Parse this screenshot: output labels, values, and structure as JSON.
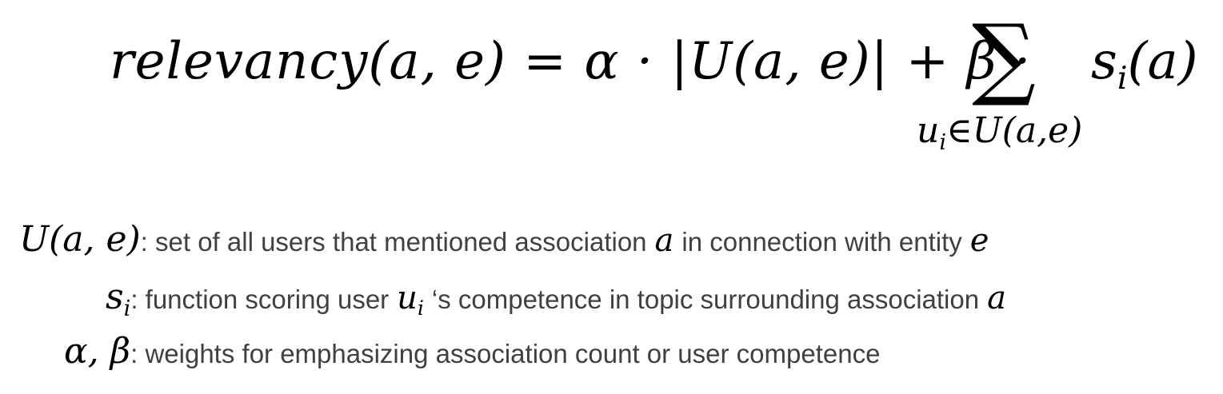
{
  "formula": {
    "lhs": "relevancy(a, e)",
    "equals": "=",
    "alpha_term": "α · |U(a, e)| + β ·",
    "sum_symbol": "∑",
    "sum_subscript_var": "u",
    "sum_subscript_index": "i",
    "sum_subscript_rest": "∈U(a,e)",
    "summand_var": "s",
    "summand_index": "i",
    "summand_arg": "(a)"
  },
  "definitions": [
    {
      "symbol": "U(a, e)",
      "text_before": ": set of all users that mentioned association",
      "inline_1": "a",
      "text_middle": "in connection with entity",
      "inline_2": "e"
    },
    {
      "symbol_var": "s",
      "symbol_index": "i",
      "text_before": ": function scoring user",
      "inline_var": "u",
      "inline_index": "i",
      "text_middle": "‘s competence in topic surrounding association",
      "inline_2": "a"
    },
    {
      "symbol": "α, β",
      "text": ": weights for emphasizing association count or user competence"
    }
  ]
}
